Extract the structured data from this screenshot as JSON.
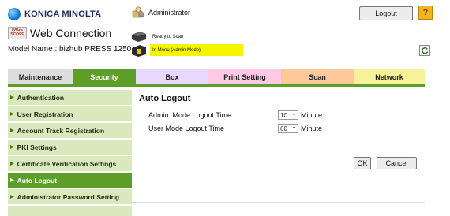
{
  "header": {
    "brand": "KONICA MINOLTA",
    "pagescope_badge": "PAGE SCOPE",
    "app_title": "Web Connection",
    "model": "Model Name : bizhub PRESS 1250",
    "user": "Administrator",
    "logout_label": "Logout",
    "help_label": "?",
    "status_ready": "Ready to Scan",
    "status_mode": "In Menu (Admin Mode)",
    "accent_color": "#5d9e28",
    "status_highlight_color": "#f5f500"
  },
  "tabs": [
    {
      "label": "Maintenance",
      "color": "#dcdcdc"
    },
    {
      "label": "Security",
      "color": "#5d9e28"
    },
    {
      "label": "Box",
      "color": "#e8d7ff"
    },
    {
      "label": "Print Setting",
      "color": "#ffc8e4"
    },
    {
      "label": "Scan",
      "color": "#ffc898"
    },
    {
      "label": "Network",
      "color": "#f7f199"
    }
  ],
  "sidebar": {
    "items": [
      {
        "label": "Authentication"
      },
      {
        "label": "User Registration"
      },
      {
        "label": "Account Track Registration"
      },
      {
        "label": "PKI Settings"
      },
      {
        "label": "Certificate Verification Settings"
      },
      {
        "label": "Auto Logout"
      },
      {
        "label": "Administrator Password Setting"
      }
    ],
    "active": "Auto Logout"
  },
  "main": {
    "title": "Auto Logout",
    "rows": [
      {
        "label": "Admin. Mode Logout Time",
        "value": "10",
        "unit": "Minute"
      },
      {
        "label": "User Mode Logout Time",
        "value": "60",
        "unit": "Minute"
      }
    ],
    "ok_label": "OK",
    "cancel_label": "Cancel"
  }
}
